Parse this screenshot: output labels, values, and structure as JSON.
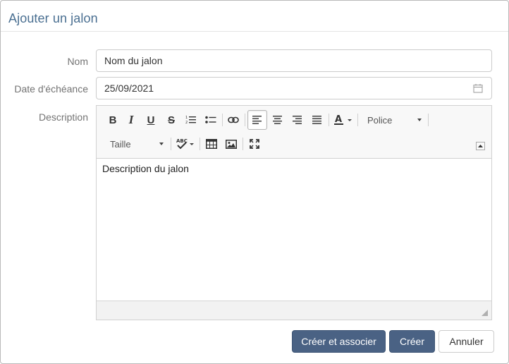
{
  "dialog": {
    "title": "Ajouter un jalon"
  },
  "form": {
    "name_label": "Nom",
    "name_value": "Nom du jalon",
    "due_label": "Date d'échéance",
    "due_value": "25/09/2021",
    "description_label": "Description"
  },
  "editor": {
    "toolbar": {
      "bold": "B",
      "italic": "I",
      "underline": "U",
      "strike": "S",
      "font_select": "Police",
      "size_select": "Taille",
      "spell_text": "ABC"
    },
    "icons": [
      "bold-icon",
      "italic-icon",
      "underline-icon",
      "strikethrough-icon",
      "ordered-list-icon",
      "unordered-list-icon",
      "link-icon",
      "align-left-icon",
      "align-center-icon",
      "align-right-icon",
      "align-justify-icon",
      "text-color-icon",
      "spellcheck-icon",
      "table-icon",
      "image-icon",
      "fullscreen-icon",
      "calendar-icon",
      "collapse-toolbar-icon",
      "resize-grip-icon"
    ],
    "content": "Description du jalon"
  },
  "footer": {
    "create_associate": "Créer et associer",
    "create": "Créer",
    "cancel": "Annuler"
  },
  "colors": {
    "title": "#4a6f91",
    "primary_button": "#4a6284",
    "label": "#737373"
  }
}
